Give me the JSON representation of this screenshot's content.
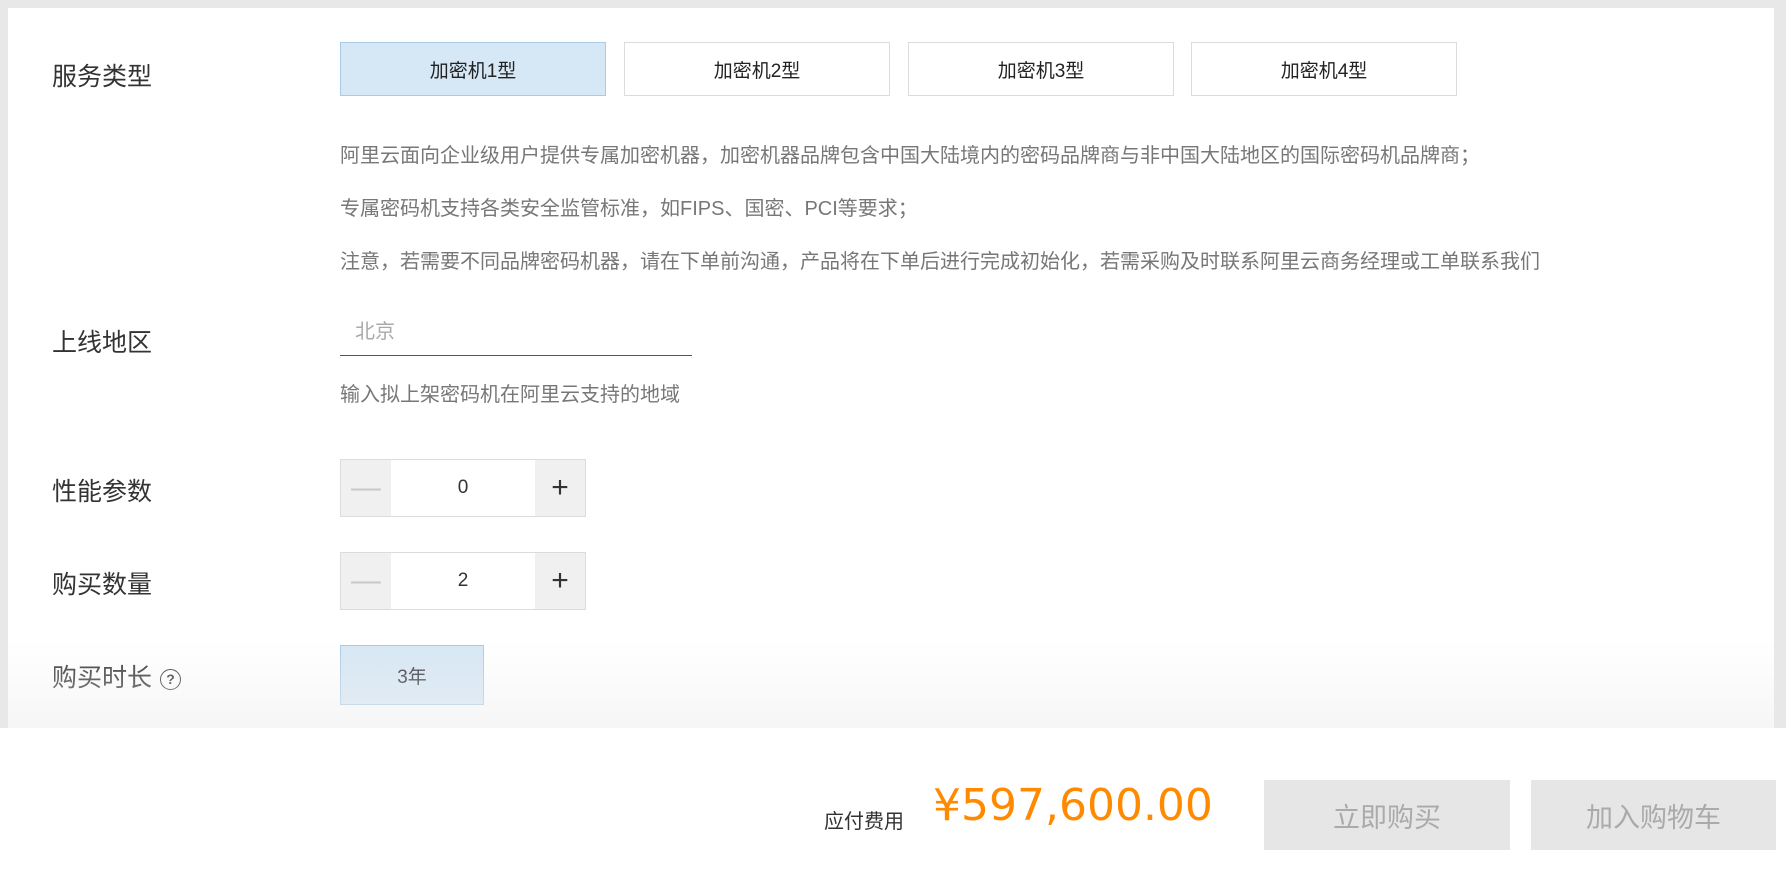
{
  "service_type": {
    "label": "服务类型",
    "options": [
      "加密机1型",
      "加密机2型",
      "加密机3型",
      "加密机4型"
    ],
    "selected_index": 0,
    "descriptions": [
      "阿里云面向企业级用户提供专属加密机器，加密机器品牌包含中国大陆境内的密码品牌商与非中国大陆地区的国际密码机品牌商；",
      "专属密码机支持各类安全监管标准，如FIPS、国密、PCI等要求；",
      "注意，若需要不同品牌密码机器，请在下单前沟通，产品将在下单后进行完成初始化，若需采购及时联系阿里云商务经理或工单联系我们"
    ]
  },
  "region": {
    "label": "上线地区",
    "placeholder": "北京",
    "value": "",
    "hint": "输入拟上架密码机在阿里云支持的地域"
  },
  "performance": {
    "label": "性能参数",
    "value": "0",
    "minus": "—",
    "plus": "+"
  },
  "quantity": {
    "label": "购买数量",
    "value": "2",
    "minus": "—",
    "plus": "+"
  },
  "duration": {
    "label": "购买时长",
    "help": "?",
    "options": [
      "3年"
    ]
  },
  "footer": {
    "price_label": "应付费用",
    "price": "¥597,600.00",
    "buy_now": "立即购买",
    "add_to_cart": "加入购物车"
  },
  "colors": {
    "accent_price": "#ff8a00",
    "selected_bg": "#d6e7f5"
  }
}
